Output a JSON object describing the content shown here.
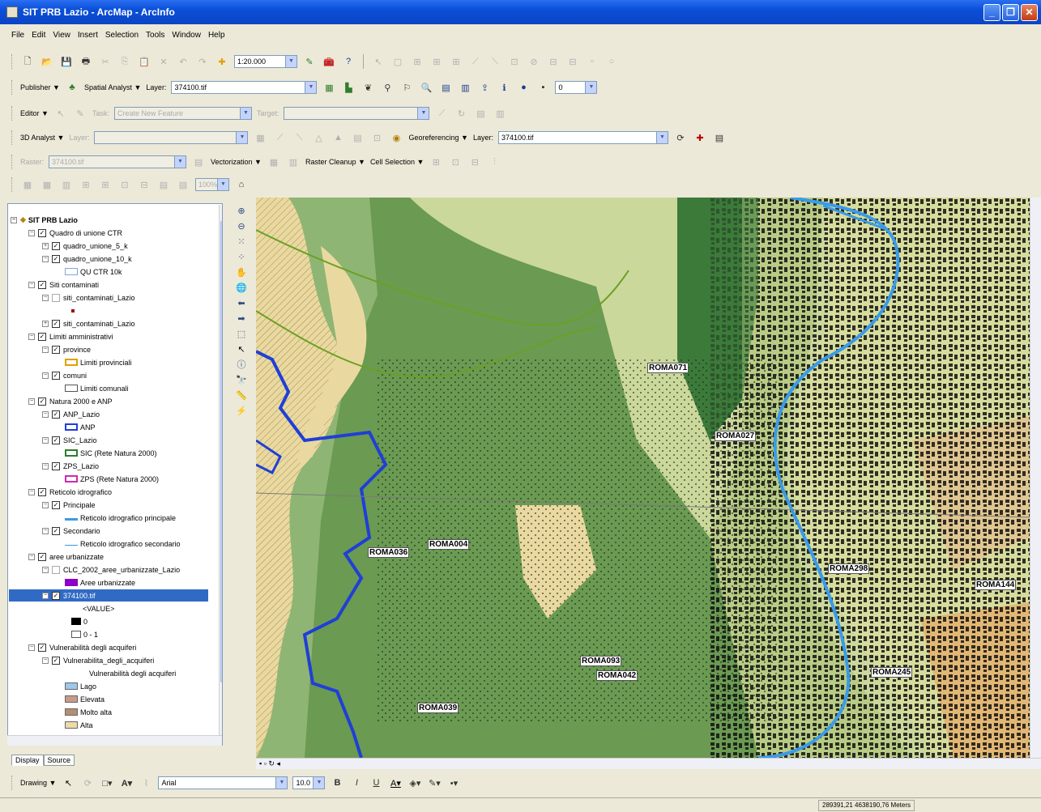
{
  "window": {
    "title": "SIT PRB Lazio - ArcMap - ArcInfo"
  },
  "menu": [
    "File",
    "Edit",
    "View",
    "Insert",
    "Selection",
    "Tools",
    "Window",
    "Help"
  ],
  "standard": {
    "scale": "1:20.000"
  },
  "publisher": {
    "publisher": "Publisher",
    "spatial_analyst": "Spatial Analyst",
    "layer_label": "Layer:",
    "layer_value": "374100.tif",
    "band": "0"
  },
  "editor": {
    "editor": "Editor",
    "task": "Task:",
    "task_value": "Create New Feature",
    "target": "Target:"
  },
  "analyst3d": {
    "analyst": "3D Analyst",
    "layer": "Layer:",
    "georef": "Georeferencing",
    "layer_label": "Layer:",
    "layer_value": "374100.tif"
  },
  "raster": {
    "raster_label": "Raster:",
    "raster_value": "374100.tif",
    "vectorization": "Vectorization",
    "cleanup": "Raster Cleanup",
    "cell": "Cell Selection"
  },
  "editorzoom": {
    "value": "100%"
  },
  "toc": {
    "items": [
      {
        "t": "SIT PRB Lazio"
      },
      {
        "t": "Quadro di unione CTR"
      },
      {
        "t": "quadro_unione_5_k"
      },
      {
        "t": "quadro_unione_10_k"
      },
      {
        "t": "QU CTR 10k"
      },
      {
        "t": "Siti contaminati"
      },
      {
        "t": "siti_contaminati_Lazio"
      },
      {
        "t": "siti_contaminati_Lazio"
      },
      {
        "t": "Limiti amministrativi"
      },
      {
        "t": "province"
      },
      {
        "t": "Limiti provinciali"
      },
      {
        "t": "comuni"
      },
      {
        "t": "Limiti comunali"
      },
      {
        "t": "Natura 2000 e ANP"
      },
      {
        "t": "ANP_Lazio"
      },
      {
        "t": "ANP"
      },
      {
        "t": "SIC_Lazio"
      },
      {
        "t": "SIC (Rete Natura 2000)"
      },
      {
        "t": "ZPS_Lazio"
      },
      {
        "t": "ZPS (Rete Natura 2000)"
      },
      {
        "t": "Reticolo idrografico"
      },
      {
        "t": "Principale"
      },
      {
        "t": "Reticolo idrografico principale"
      },
      {
        "t": "Secondario"
      },
      {
        "t": "Reticolo idrografico secondario"
      },
      {
        "t": "aree urbanizzate"
      },
      {
        "t": "CLC_2002_aree_urbanizzate_Lazio"
      },
      {
        "t": "Aree urbanizzate"
      },
      {
        "t": "374100.tif"
      },
      {
        "t": "<VALUE>"
      },
      {
        "t": "0"
      },
      {
        "t": "0 - 1"
      },
      {
        "t": "Vulnerabilità degli acquiferi"
      },
      {
        "t": "Vulnerabilita_degli_acquiferi"
      },
      {
        "t": "Vulnerabilità degli acquiferi"
      },
      {
        "t": "Lago"
      },
      {
        "t": "Elevata"
      },
      {
        "t": "Molto alta"
      },
      {
        "t": "Alta"
      }
    ],
    "tabs": [
      "Display",
      "Source"
    ]
  },
  "map": {
    "labels": [
      "ROMA071",
      "ROMA027",
      "ROMA036",
      "ROMA004",
      "ROMA298",
      "ROMA144",
      "ROMA093",
      "ROMA042",
      "ROMA245",
      "ROMA039"
    ]
  },
  "drawing": {
    "label": "Drawing",
    "font": "Arial",
    "size": "10.0"
  },
  "status": {
    "coords": "289391,21  4638190,76 Meters"
  },
  "colors": {
    "title": "#0a4fd8",
    "selection": "#316ac5",
    "river": "#3a9be8",
    "anp": "#1f3fd6"
  }
}
